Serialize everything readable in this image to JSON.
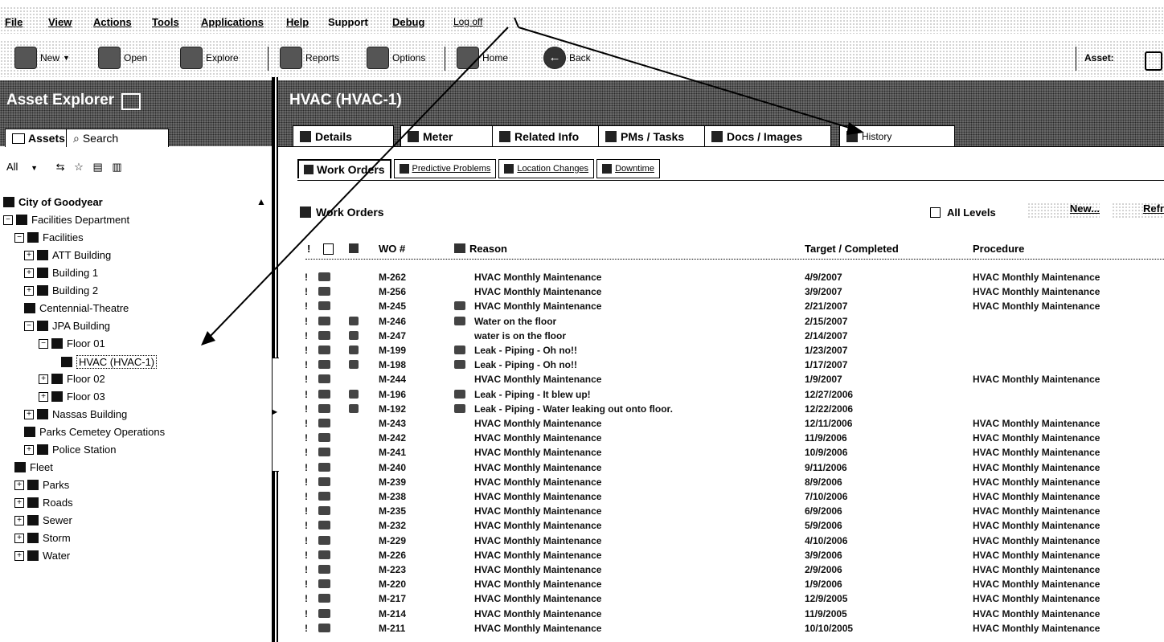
{
  "menu": [
    "File",
    "View",
    "Actions",
    "Tools",
    "Applications",
    "Help",
    "Support",
    "Debug",
    "Log off"
  ],
  "toolbar": {
    "new": "New",
    "open": "Open",
    "explore": "Explore",
    "reports": "Reports",
    "options": "Options",
    "home": "Home",
    "back": "Back",
    "asset": "Asset:"
  },
  "explorer": {
    "title": "Asset Explorer",
    "tab_assets": "Assets",
    "tab_search": "Search",
    "filter": "All"
  },
  "tree": [
    {
      "label": "City of Goodyear",
      "level": 0,
      "pm": ""
    },
    {
      "label": "Facilities Department",
      "level": 0,
      "pm": "−"
    },
    {
      "label": "Facilities",
      "level": 1,
      "pm": "−"
    },
    {
      "label": "ATT Building",
      "level": 2,
      "pm": "+"
    },
    {
      "label": "Building 1",
      "level": 2,
      "pm": "+"
    },
    {
      "label": "Building 2",
      "level": 2,
      "pm": "+"
    },
    {
      "label": "Centennial-Theatre",
      "level": 2,
      "pm": ""
    },
    {
      "label": "JPA Building",
      "level": 2,
      "pm": "−"
    },
    {
      "label": "Floor 01",
      "level": 3,
      "pm": "−"
    },
    {
      "label": "HVAC (HVAC-1)",
      "level": 4,
      "pm": "",
      "selected": true
    },
    {
      "label": "Floor 02",
      "level": 3,
      "pm": "+"
    },
    {
      "label": "Floor 03",
      "level": 3,
      "pm": "+"
    },
    {
      "label": "Nassas Building",
      "level": 2,
      "pm": "+"
    },
    {
      "label": "Parks Cemetey Operations",
      "level": 2,
      "pm": ""
    },
    {
      "label": "Police Station",
      "level": 2,
      "pm": "+"
    },
    {
      "label": "Fleet",
      "level": 1,
      "pm": ""
    },
    {
      "label": "Parks",
      "level": 1,
      "pm": "+"
    },
    {
      "label": "Roads",
      "level": 1,
      "pm": "+"
    },
    {
      "label": "Sewer",
      "level": 1,
      "pm": "+"
    },
    {
      "label": "Storm",
      "level": 1,
      "pm": "+"
    },
    {
      "label": "Water",
      "level": 1,
      "pm": "+"
    }
  ],
  "asset_title": "HVAC (HVAC-1)",
  "tabs": [
    "Details",
    "Meter",
    "Related Info",
    "PMs / Tasks",
    "Docs / Images",
    "History"
  ],
  "subtabs": [
    "Work Orders",
    "Predictive Problems",
    "Location Changes",
    "Downtime"
  ],
  "work_orders": {
    "title": "Work Orders",
    "all_levels": "All Levels",
    "new": "New...",
    "refresh": "Refr",
    "columns": {
      "excl": "!",
      "wo": "WO #",
      "reason": "Reason",
      "target": "Target / Completed",
      "procedure": "Procedure"
    },
    "rows": [
      {
        "wo": "M-262",
        "reason": "HVAC Monthly Maintenance",
        "target": "4/9/2007",
        "procedure": "HVAC Monthly Maintenance",
        "i2": false,
        "i3": false
      },
      {
        "wo": "M-256",
        "reason": "HVAC Monthly Maintenance",
        "target": "3/9/2007",
        "procedure": "HVAC Monthly Maintenance",
        "i2": false,
        "i3": false
      },
      {
        "wo": "M-245",
        "reason": "HVAC Monthly Maintenance",
        "target": "2/21/2007",
        "procedure": "HVAC Monthly Maintenance",
        "i2": false,
        "i3": true
      },
      {
        "wo": "M-246",
        "reason": "Water on the floor",
        "target": "2/15/2007",
        "procedure": "",
        "i2": true,
        "i3": true
      },
      {
        "wo": "M-247",
        "reason": "water is on the floor",
        "target": "2/14/2007",
        "procedure": "",
        "i2": true,
        "i3": false
      },
      {
        "wo": "M-199",
        "reason": "Leak - Piping - Oh no!!",
        "target": "1/23/2007",
        "procedure": "",
        "i2": true,
        "i3": true
      },
      {
        "wo": "M-198",
        "reason": "Leak - Piping - Oh no!!",
        "target": "1/17/2007",
        "procedure": "",
        "i2": true,
        "i3": true
      },
      {
        "wo": "M-244",
        "reason": "HVAC Monthly Maintenance",
        "target": "1/9/2007",
        "procedure": "HVAC Monthly Maintenance",
        "i2": false,
        "i3": false
      },
      {
        "wo": "M-196",
        "reason": "Leak - Piping - It blew up!",
        "target": "12/27/2006",
        "procedure": "",
        "i2": true,
        "i3": true
      },
      {
        "wo": "M-192",
        "reason": "Leak - Piping - Water leaking out onto floor.",
        "target": "12/22/2006",
        "procedure": "",
        "i2": true,
        "i3": true
      },
      {
        "wo": "M-243",
        "reason": "HVAC Monthly Maintenance",
        "target": "12/11/2006",
        "procedure": "HVAC Monthly Maintenance",
        "i2": false,
        "i3": false
      },
      {
        "wo": "M-242",
        "reason": "HVAC Monthly Maintenance",
        "target": "11/9/2006",
        "procedure": "HVAC Monthly Maintenance",
        "i2": false,
        "i3": false
      },
      {
        "wo": "M-241",
        "reason": "HVAC Monthly Maintenance",
        "target": "10/9/2006",
        "procedure": "HVAC Monthly Maintenance",
        "i2": false,
        "i3": false
      },
      {
        "wo": "M-240",
        "reason": "HVAC Monthly Maintenance",
        "target": "9/11/2006",
        "procedure": "HVAC Monthly Maintenance",
        "i2": false,
        "i3": false
      },
      {
        "wo": "M-239",
        "reason": "HVAC Monthly Maintenance",
        "target": "8/9/2006",
        "procedure": "HVAC Monthly Maintenance",
        "i2": false,
        "i3": false
      },
      {
        "wo": "M-238",
        "reason": "HVAC Monthly Maintenance",
        "target": "7/10/2006",
        "procedure": "HVAC Monthly Maintenance",
        "i2": false,
        "i3": false
      },
      {
        "wo": "M-235",
        "reason": "HVAC Monthly Maintenance",
        "target": "6/9/2006",
        "procedure": "HVAC Monthly Maintenance",
        "i2": false,
        "i3": false
      },
      {
        "wo": "M-232",
        "reason": "HVAC Monthly Maintenance",
        "target": "5/9/2006",
        "procedure": "HVAC Monthly Maintenance",
        "i2": false,
        "i3": false
      },
      {
        "wo": "M-229",
        "reason": "HVAC Monthly Maintenance",
        "target": "4/10/2006",
        "procedure": "HVAC Monthly Maintenance",
        "i2": false,
        "i3": false
      },
      {
        "wo": "M-226",
        "reason": "HVAC Monthly Maintenance",
        "target": "3/9/2006",
        "procedure": "HVAC Monthly Maintenance",
        "i2": false,
        "i3": false
      },
      {
        "wo": "M-223",
        "reason": "HVAC Monthly Maintenance",
        "target": "2/9/2006",
        "procedure": "HVAC Monthly Maintenance",
        "i2": false,
        "i3": false
      },
      {
        "wo": "M-220",
        "reason": "HVAC Monthly Maintenance",
        "target": "1/9/2006",
        "procedure": "HVAC Monthly Maintenance",
        "i2": false,
        "i3": false
      },
      {
        "wo": "M-217",
        "reason": "HVAC Monthly Maintenance",
        "target": "12/9/2005",
        "procedure": "HVAC Monthly Maintenance",
        "i2": false,
        "i3": false
      },
      {
        "wo": "M-214",
        "reason": "HVAC Monthly Maintenance",
        "target": "11/9/2005",
        "procedure": "HVAC Monthly Maintenance",
        "i2": false,
        "i3": false
      },
      {
        "wo": "M-211",
        "reason": "HVAC Monthly Maintenance",
        "target": "10/10/2005",
        "procedure": "HVAC Monthly Maintenance",
        "i2": false,
        "i3": false
      }
    ]
  }
}
